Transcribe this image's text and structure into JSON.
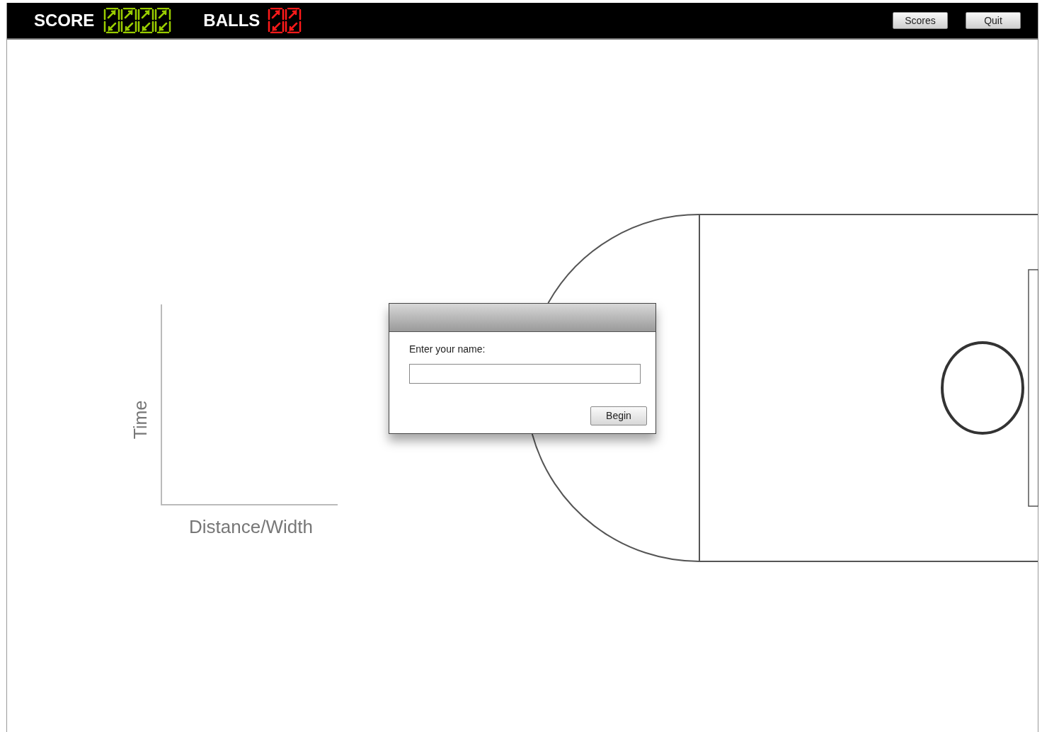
{
  "top_bar": {
    "score_label": "SCORE",
    "balls_label": "BALLS",
    "buttons": [
      "Scores",
      "Quit"
    ]
  },
  "graph": {
    "ylabel": "Time",
    "xlabel": "Distance/Width"
  },
  "dialog": {
    "label": "Enter your name:",
    "button": "Begin"
  }
}
